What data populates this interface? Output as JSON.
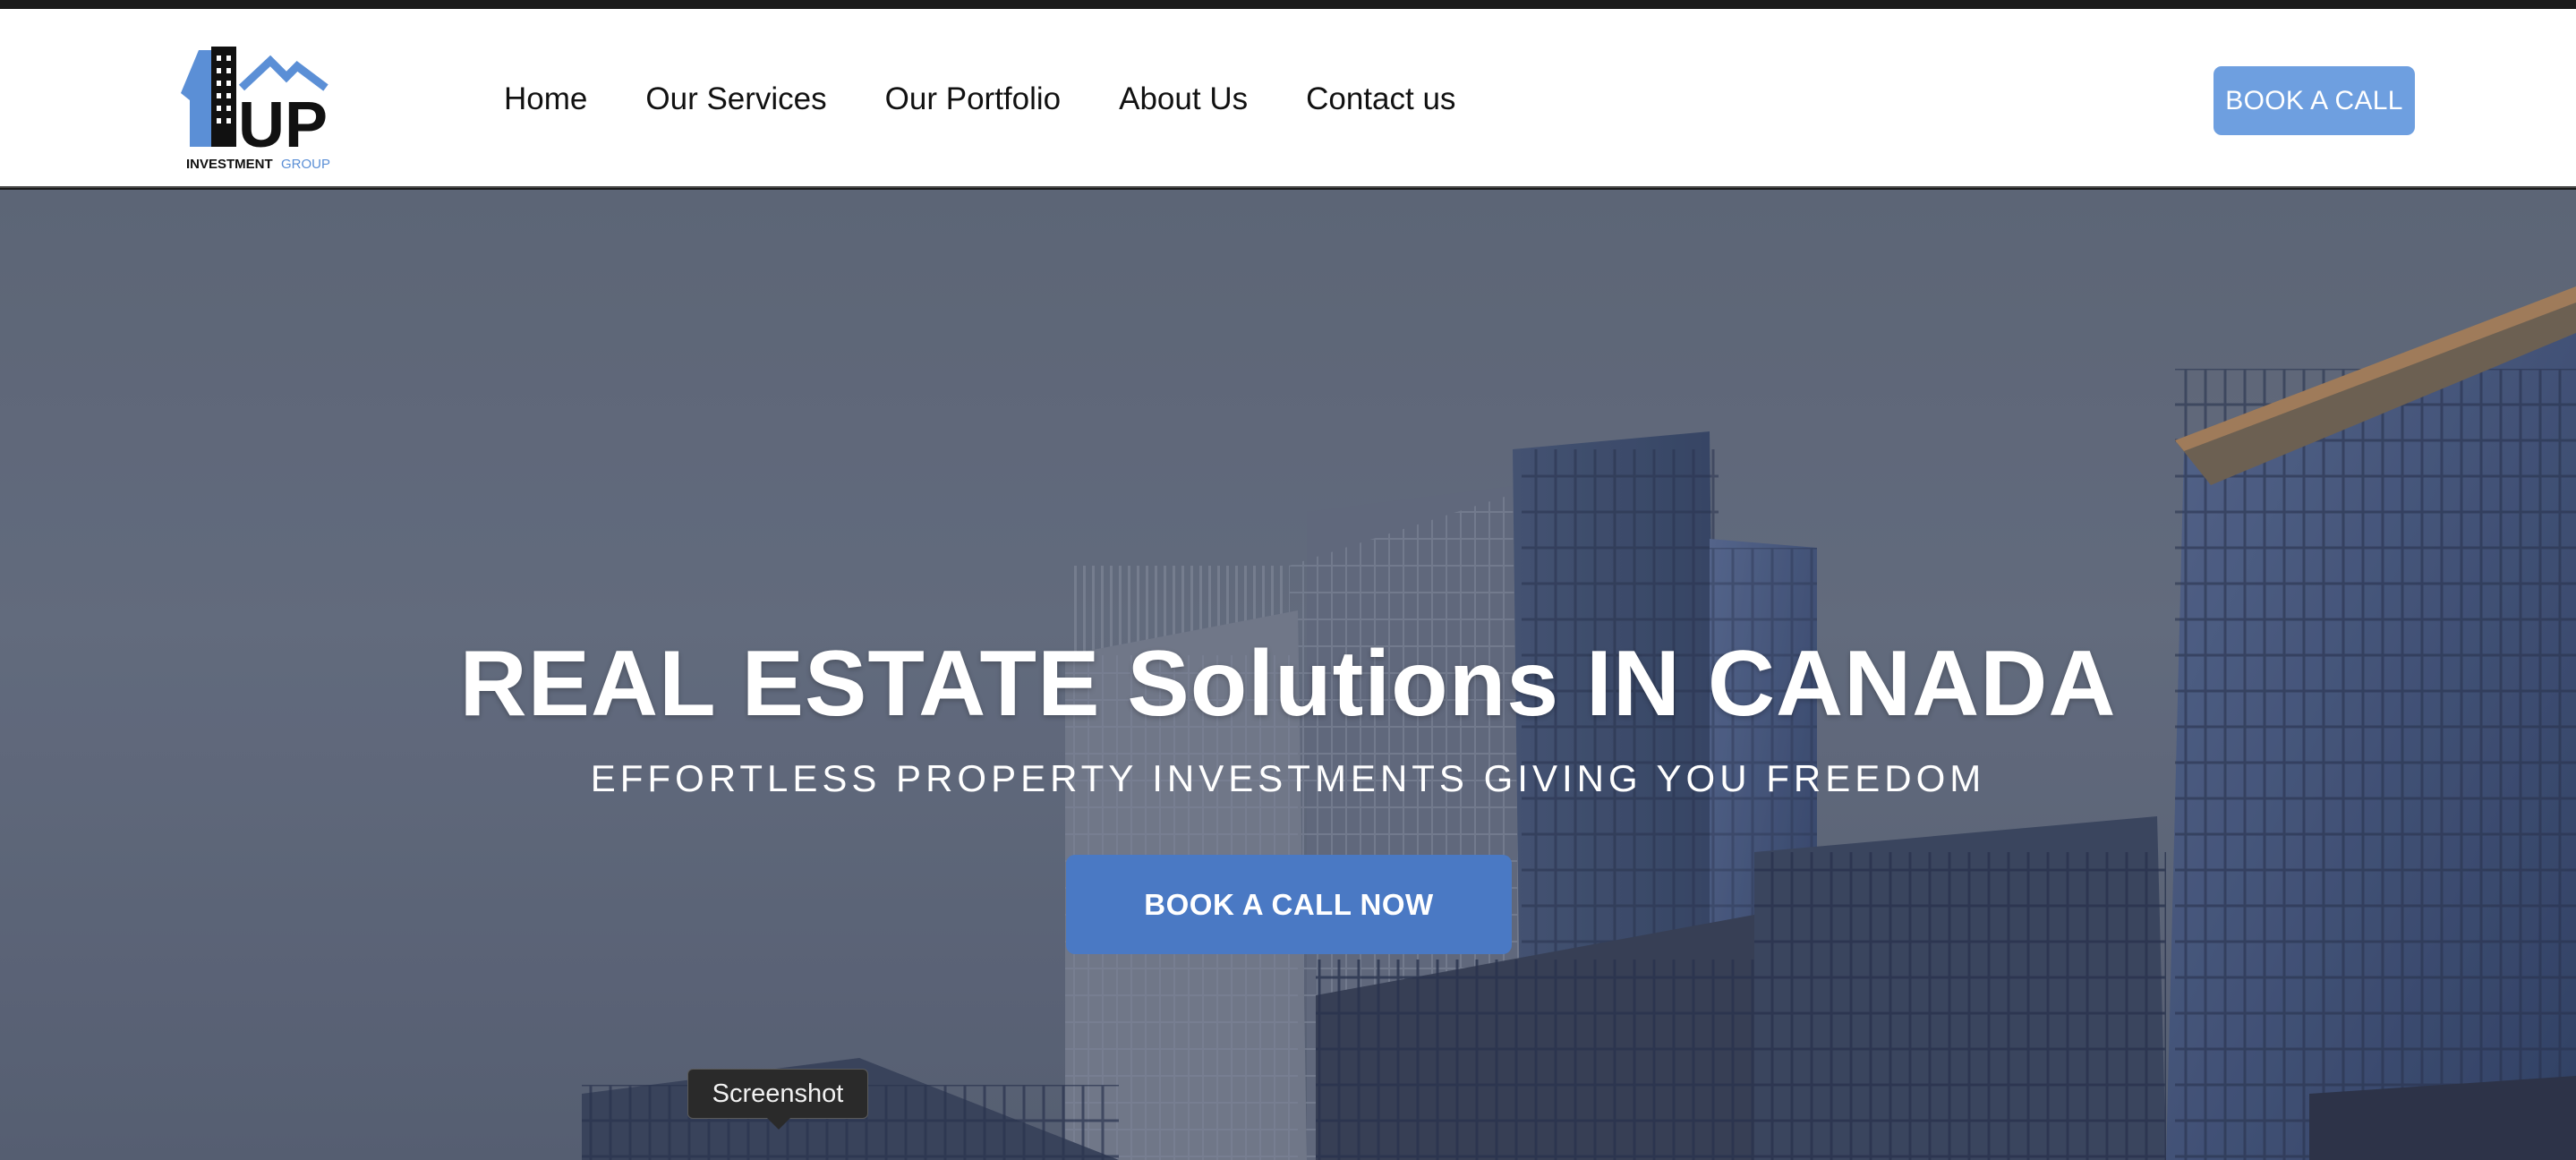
{
  "logo": {
    "mark_primary": "1",
    "mark_secondary": "UP",
    "line_a": "INVESTMENT",
    "line_b": "GROUP",
    "brand_color": "#5b8fd6"
  },
  "nav": {
    "items": [
      {
        "label": "Home"
      },
      {
        "label": "Our Services"
      },
      {
        "label": "Our Portfolio"
      },
      {
        "label": "About Us"
      },
      {
        "label": "Contact us"
      }
    ]
  },
  "header": {
    "cta_label": "BOOK A CALL",
    "cta_color": "#6e9fe0"
  },
  "hero": {
    "title": "REAL ESTATE Solutions IN CANADA",
    "subtitle": "EFFORTLESS PROPERTY INVESTMENTS GIVING YOU FREEDOM",
    "cta_label": "BOOK A CALL NOW",
    "cta_color": "#4a79c4",
    "background": "city-skyline-photo"
  },
  "tooltip": {
    "text": "Screenshot"
  }
}
